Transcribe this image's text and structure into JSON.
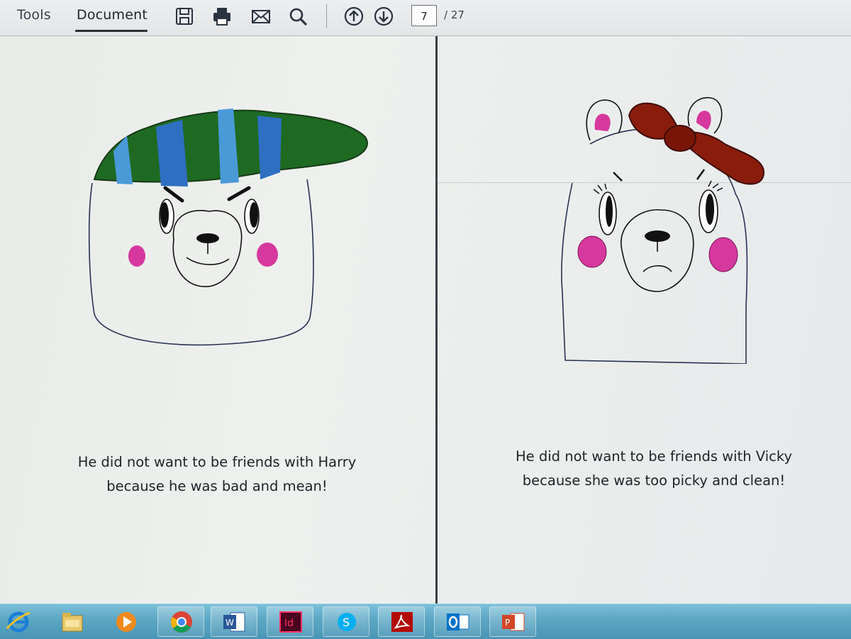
{
  "toolbar": {
    "tabs": [
      {
        "label": "Tools"
      },
      {
        "label": "Document",
        "active": true
      }
    ],
    "icons": [
      "save-icon",
      "print-icon",
      "email-icon",
      "search-icon",
      "page-up-icon",
      "page-down-icon"
    ],
    "page": {
      "current": "7",
      "total": "/ 27"
    }
  },
  "pages": {
    "left": {
      "caption_line1": "He did not want to be friends with Harry",
      "caption_line2": "because he was bad and mean!",
      "drawing": "bear-with-striped-cap-icon"
    },
    "right": {
      "caption_line1": "He did not want to be friends with Vicky",
      "caption_line2": "because she was too picky and clean!",
      "drawing": "bear-with-red-bow-icon"
    }
  },
  "taskbar": {
    "apps": [
      "internet-explorer-icon",
      "file-explorer-icon",
      "media-player-icon",
      "chrome-icon",
      "word-icon",
      "indesign-icon",
      "skype-icon",
      "acrobat-icon",
      "outlook-icon",
      "powerpoint-icon"
    ]
  },
  "colors": {
    "cap_green": "#1f6b1f",
    "cap_blue": "#2f6fc2",
    "cheek_pink": "#d6389e",
    "bow_red": "#8a1c0c",
    "taskbar": "#5aa6c3"
  }
}
